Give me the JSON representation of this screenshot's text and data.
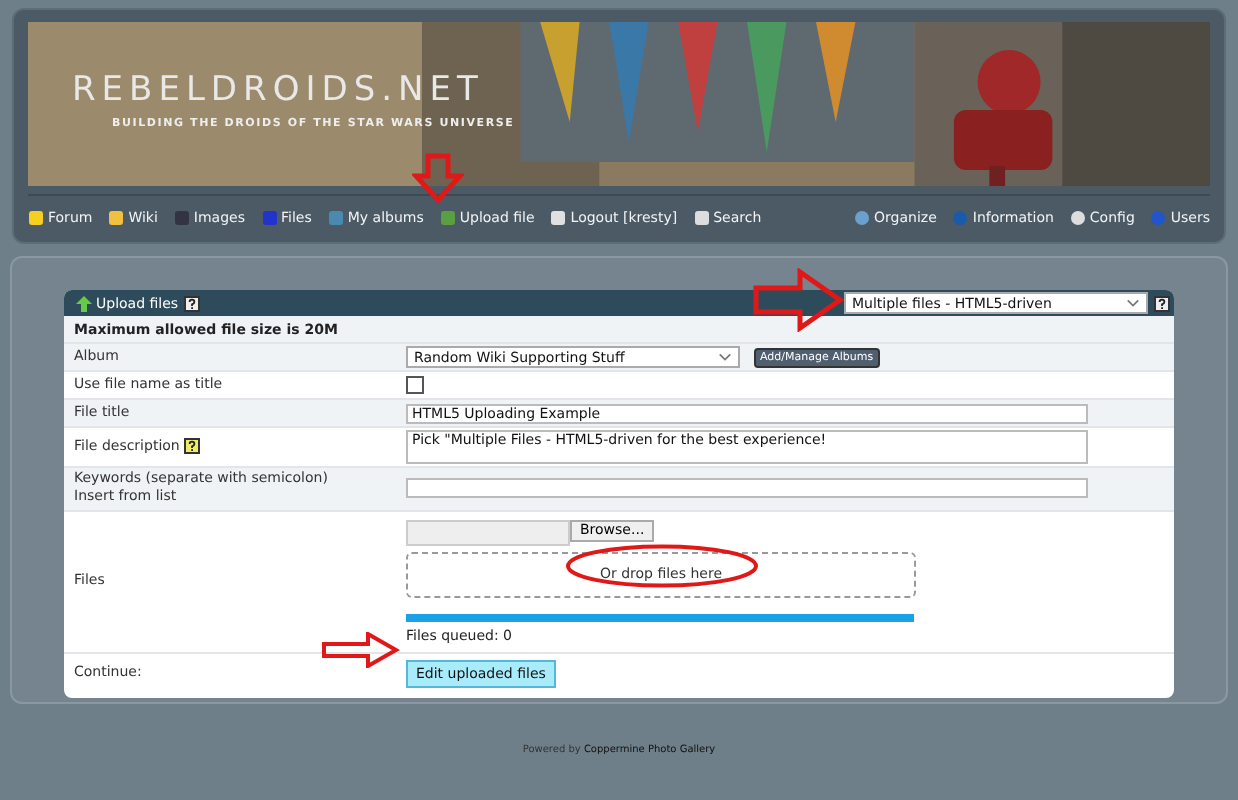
{
  "banner": {
    "title": "REBELDROIDS.NET",
    "tagline": "BUILDING THE DROIDS OF THE STAR WARS UNIVERSE"
  },
  "nav_left": [
    {
      "label": "Forum"
    },
    {
      "label": "Wiki"
    },
    {
      "label": "Images"
    },
    {
      "label": "Files"
    },
    {
      "label": "My albums"
    },
    {
      "label": "Upload file"
    },
    {
      "label": "Logout [kresty]"
    },
    {
      "label": "Search"
    }
  ],
  "nav_right": [
    {
      "label": "Organize"
    },
    {
      "label": "Information"
    },
    {
      "label": "Config"
    },
    {
      "label": "Users"
    }
  ],
  "upload": {
    "title": "Upload files",
    "method": "Multiple files - HTML5-driven",
    "max_size": "Maximum allowed file size is 20M",
    "album_label": "Album",
    "album": "Random Wiki Supporting Stuff",
    "album_button": "Add/Manage Albums",
    "use_name_label": "Use file name as title",
    "use_name_checked": false,
    "title_label": "File title",
    "title_value": "HTML5 Uploading Example",
    "desc_label": "File description",
    "desc_value": "Pick \"Multiple Files - HTML5-driven for the best experience!",
    "keywords_label": "Keywords (separate with semicolon)",
    "keywords_sub": "Insert from list",
    "files_label": "Files",
    "browse": "Browse...",
    "drop": "Or drop files here",
    "level": 1,
    "queued": "Files queued: 0",
    "continue_label": "Continue:",
    "continue_button": "Edit uploaded files"
  },
  "footer": {
    "prefix": "Powered by",
    "link": "Coppermine Photo Gallery"
  }
}
